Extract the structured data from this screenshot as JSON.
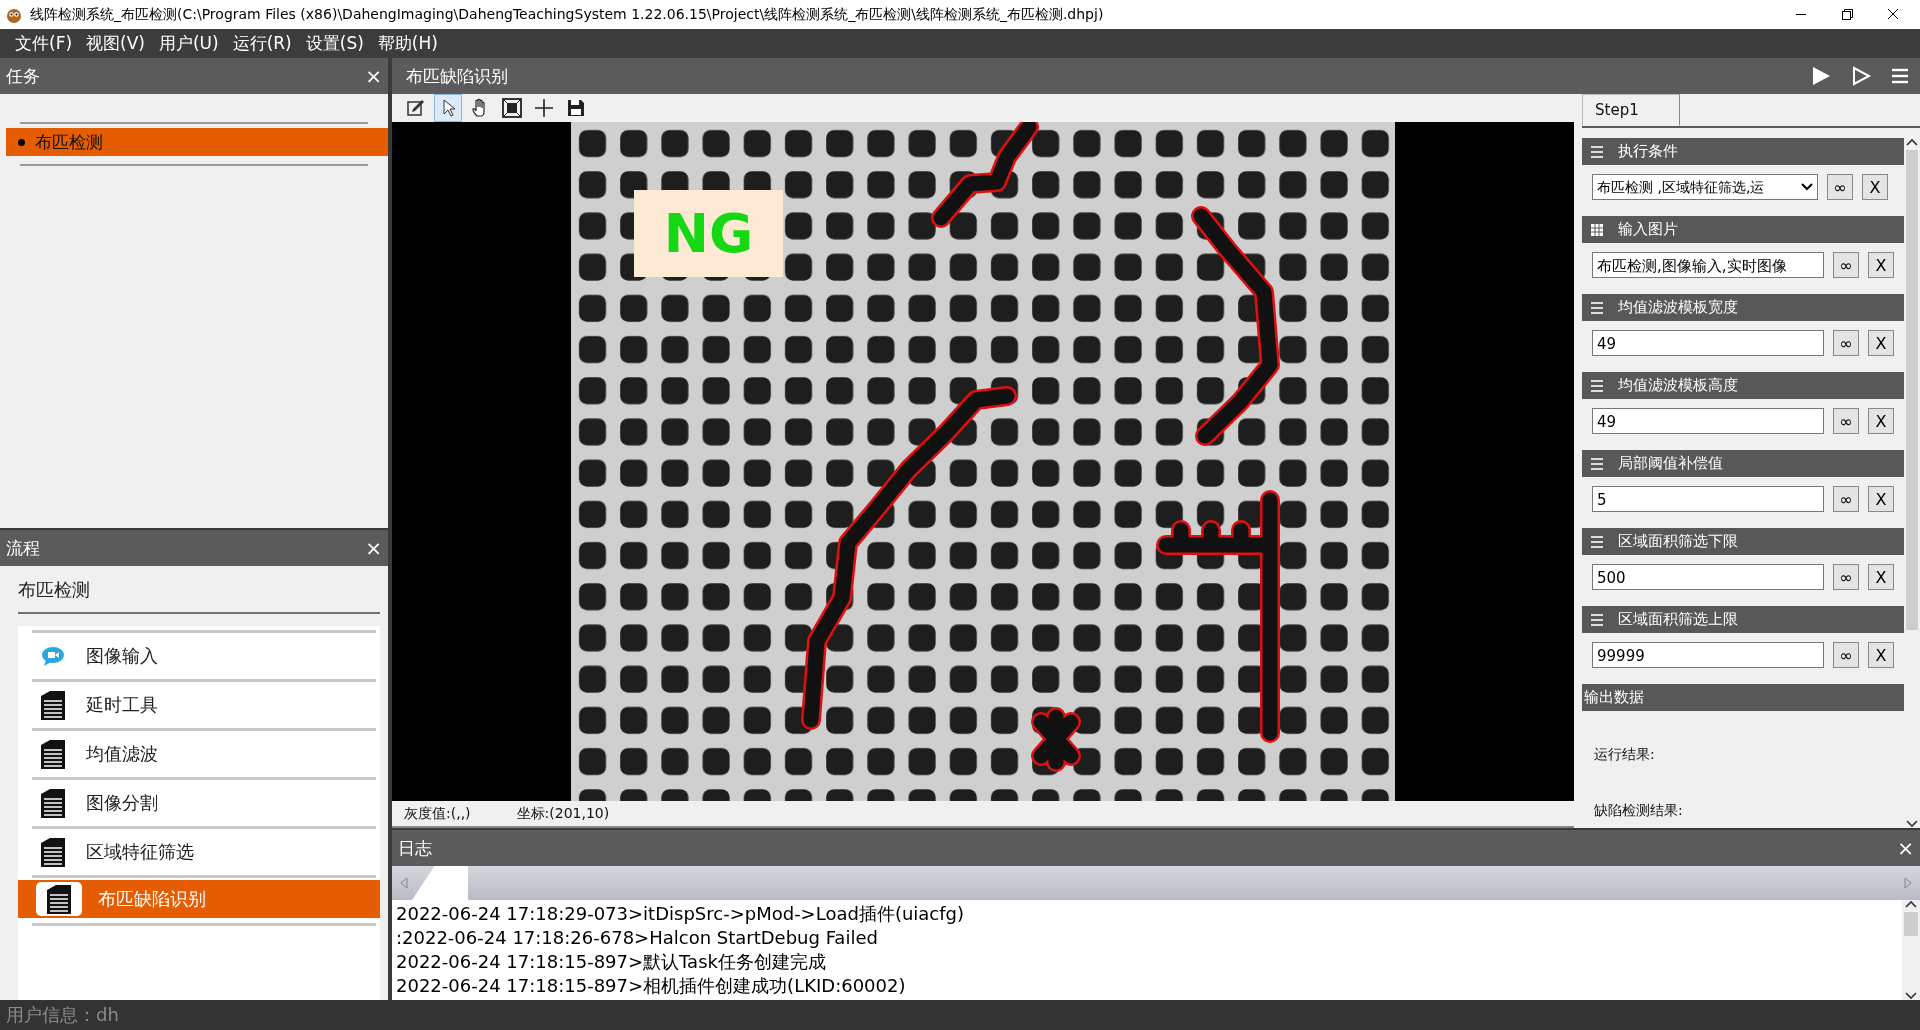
{
  "window": {
    "title": "线阵检测系统_布匹检测(C:\\Program Files (x86)\\DahengImaging\\DahengTeachingSystem 1.22.06.15\\Project\\线阵检测系统_布匹检测\\线阵检测系统_布匹检测.dhpj)"
  },
  "menu": [
    "文件(F)",
    "视图(V)",
    "用户(U)",
    "运行(R)",
    "设置(S)",
    "帮助(H)"
  ],
  "task_panel": {
    "title": "任务",
    "close": "×",
    "items": [
      {
        "label": "布匹检测",
        "selected": true
      }
    ]
  },
  "flow_panel": {
    "title": "流程",
    "close": "×",
    "project": "布匹检测",
    "steps": [
      {
        "label": "图像输入",
        "kind": "camera",
        "selected": false
      },
      {
        "label": "延时工具",
        "kind": "document",
        "selected": false
      },
      {
        "label": "均值滤波",
        "kind": "document",
        "selected": false
      },
      {
        "label": "图像分割",
        "kind": "document",
        "selected": false
      },
      {
        "label": "区域特征筛选",
        "kind": "document",
        "selected": false
      },
      {
        "label": "布匹缺陷识别",
        "kind": "document",
        "selected": true
      }
    ]
  },
  "view": {
    "title": "布匹缺陷识别",
    "tools": [
      {
        "kind": "edit",
        "selected": false
      },
      {
        "kind": "pointer",
        "selected": true
      },
      {
        "kind": "hand",
        "selected": false
      },
      {
        "kind": "fit",
        "selected": false
      },
      {
        "kind": "cross",
        "selected": false
      },
      {
        "kind": "save",
        "selected": false
      }
    ],
    "result": "NG",
    "gray_value": "灰度值:(,,)",
    "coordinate": "坐标:(201,10)"
  },
  "properties": {
    "tabs": [
      {
        "label": "Step1",
        "selected": true
      }
    ],
    "params": [
      {
        "title": "执行条件",
        "kind": "dropdown",
        "value": "布匹检测 ,区域特征筛选,运",
        "link": "∞",
        "clear": "X"
      },
      {
        "title": "输入图片",
        "kind": "image",
        "value": "布匹检测,图像输入,实时图像",
        "link": "∞",
        "clear": "X"
      },
      {
        "title": "均值滤波模板宽度",
        "kind": "text",
        "value": "49",
        "link": "∞",
        "clear": "X"
      },
      {
        "title": "均值滤波模板高度",
        "kind": "text",
        "value": "49",
        "link": "∞",
        "clear": "X"
      },
      {
        "title": "局部阈值补偿值",
        "kind": "text",
        "value": "5",
        "link": "∞",
        "clear": "X"
      },
      {
        "title": "区域面积筛选下限",
        "kind": "text",
        "value": "500",
        "link": "∞",
        "clear": "X"
      },
      {
        "title": "区域面积筛选上限",
        "kind": "text",
        "value": "99999",
        "link": "∞",
        "clear": "X"
      }
    ],
    "output_title": "输出数据",
    "outputs": [
      "运行结果:",
      "缺陷检测结果:"
    ]
  },
  "log": {
    "title": "日志",
    "close": "×",
    "lines": [
      "2022-06-24 17:18:29-073>itDispSrc->pMod->Load插件(uiacfg)",
      ":2022-06-24 17:18:26-678>Halcon StartDebug Failed",
      "2022-06-24 17:18:15-897>默认Task任务创建完成",
      "2022-06-24 17:18:15-897>相机插件创建成功(LKID:60002)"
    ]
  },
  "status_bar": {
    "user": "用户信息：dh"
  }
}
